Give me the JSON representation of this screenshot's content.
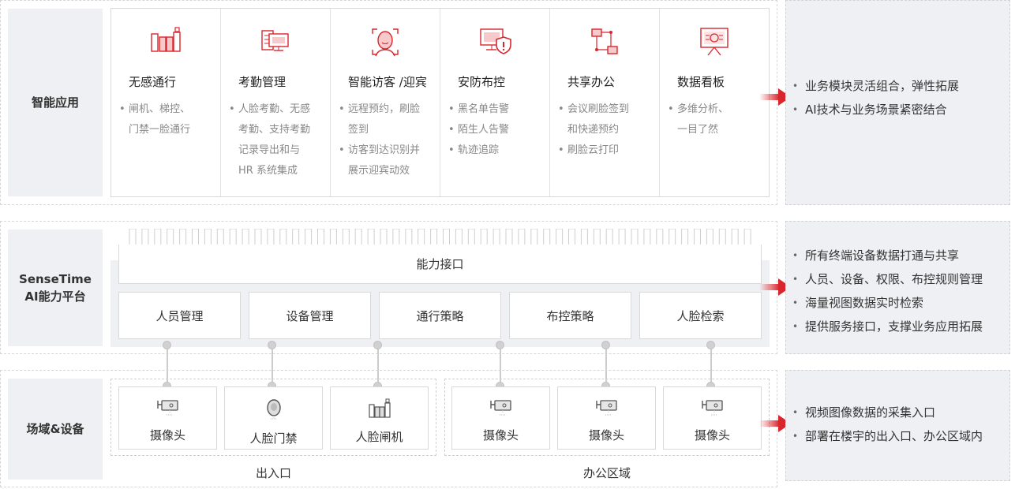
{
  "rows": {
    "app": {
      "label": "智能应用"
    },
    "platform": {
      "label_line1": "SenseTime",
      "label_line2": "AI能力平台"
    },
    "site": {
      "label": "场域&设备"
    }
  },
  "apps": [
    {
      "title": "无感通行",
      "icon": "turnstile-icon",
      "bullets": [
        [
          "闸机、梯控、",
          "门禁一脸通行"
        ]
      ]
    },
    {
      "title": "考勤管理",
      "icon": "attendance-monitor-icon",
      "bullets": [
        [
          "人脸考勤、无感",
          "考勤、支持考勤",
          "记录导出和与",
          "HR 系统集成"
        ]
      ]
    },
    {
      "title": "智能访客 /迎宾",
      "icon": "face-scan-icon",
      "bullets": [
        [
          "远程预约，刷脸",
          "签到"
        ],
        [
          "访客到达识别并",
          "展示迎宾动效"
        ]
      ]
    },
    {
      "title": "安防布控",
      "icon": "security-alert-monitor-icon",
      "bullets": [
        [
          "黑名单告警"
        ],
        [
          "陌生人告警"
        ],
        [
          "轨迹追踪"
        ]
      ]
    },
    {
      "title": "共享办公",
      "icon": "shared-office-icon",
      "bullets": [
        [
          "会议刷脸签到",
          "和快递预约"
        ],
        [
          "刷脸云打印"
        ]
      ]
    },
    {
      "title": "数据看板",
      "icon": "dashboard-screen-icon",
      "bullets": [
        [
          "多维分析、",
          "一目了然"
        ]
      ]
    }
  ],
  "app_summary": [
    "业务模块灵活组合，弹性拓展",
    "AI技术与业务场景紧密结合"
  ],
  "platform": {
    "interface_label": "能力接口",
    "modules": [
      "人员管理",
      "设备管理",
      "通行策略",
      "布控策略",
      "人脸检索"
    ]
  },
  "platform_summary": [
    "所有终端设备数据打通与共享",
    "人员、设备、权限、布控规则管理",
    "海量视图数据实时检索",
    "提供服务接口，支撑业务应用拓展"
  ],
  "devices": {
    "entrance": {
      "label": "出入口",
      "items": [
        {
          "label": "摄像头",
          "icon": "camera-icon"
        },
        {
          "label": "人脸门禁",
          "icon": "face-access-icon"
        },
        {
          "label": "人脸闸机",
          "icon": "face-gate-icon"
        }
      ]
    },
    "office": {
      "label": "办公区域",
      "items": [
        {
          "label": "摄像头",
          "icon": "camera-icon"
        },
        {
          "label": "摄像头",
          "icon": "camera-icon"
        },
        {
          "label": "摄像头",
          "icon": "camera-icon"
        }
      ]
    }
  },
  "site_summary": [
    "视频图像数据的采集入口",
    "部署在楼宇的出入口、办公区域内"
  ],
  "colors": {
    "accent": "#d9262d",
    "panel": "#eef0f3",
    "border": "#d9d9d9"
  }
}
